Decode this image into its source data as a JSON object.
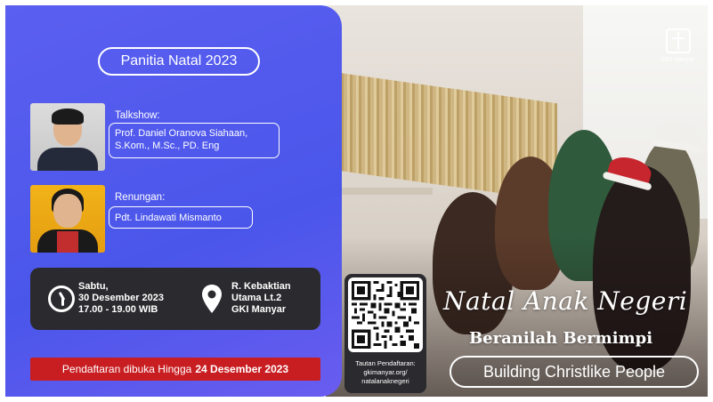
{
  "committee_title": "Panitia Natal 2023",
  "talkshow": {
    "label": "Talkshow:",
    "speaker_line1": "Prof. Daniel Oranova Siahaan,",
    "speaker_line2": "S.Kom., M.Sc., PD. Eng"
  },
  "renungan": {
    "label": "Renungan:",
    "speaker": "Pdt. Lindawati Mismanto"
  },
  "schedule": {
    "day": "Sabtu,",
    "date": "30 Desember 2023",
    "time": "17.00 - 19.00 WIB",
    "clock_icon": "clock-icon"
  },
  "location": {
    "line1": "R. Kebaktian",
    "line2": "Utama Lt.2",
    "line3": "GKI Manyar",
    "pin_icon": "location-pin-icon"
  },
  "registration": {
    "text": "Pendaftaran dibuka Hingga",
    "deadline": "24 Desember 2023"
  },
  "qr": {
    "caption_line1": "Tautan Pendaftaran:",
    "caption_line2": "gkimanyar.org/",
    "caption_line3": "natalanaknegeri"
  },
  "event": {
    "title": "Natal Anak Negeri",
    "subtitle": "Beranilah Bermimpi",
    "tagline": "Building Christlike People"
  },
  "logo": {
    "text": "GKI Manyar"
  },
  "colors": {
    "panel_blue": "#5058ee",
    "card_dark": "#2b2b2f",
    "registration_red": "#c81e22"
  }
}
